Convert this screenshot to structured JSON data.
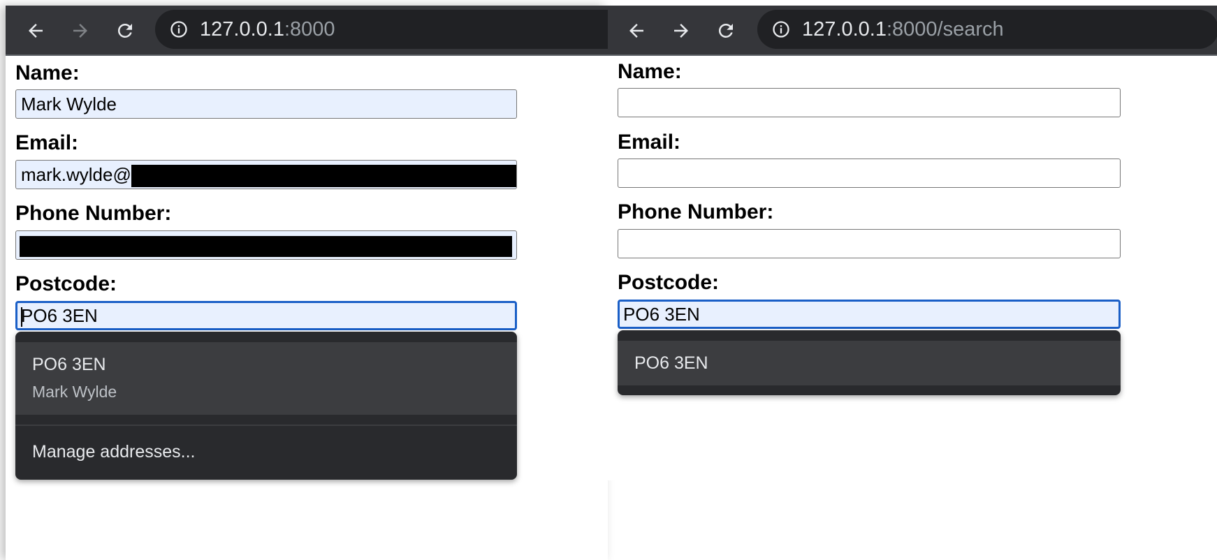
{
  "left_window": {
    "toolbar": {
      "back_icon": "arrow-left-icon",
      "forward_icon": "arrow-right-icon",
      "reload_icon": "reload-icon",
      "info_icon": "info-circle-icon",
      "url_host": "127.0.0.1",
      "url_rest": ":8000"
    },
    "form": {
      "name_label": "Name:",
      "name_value": "Mark Wylde",
      "email_label": "Email:",
      "email_value": "mark.wylde@",
      "phone_label": "Phone Number:",
      "phone_value": "",
      "postcode_label": "Postcode:",
      "postcode_value": "PO6 3EN"
    },
    "autofill": {
      "suggestion_title": "PO6 3EN",
      "suggestion_subtitle": "Mark Wylde",
      "manage_label": "Manage addresses..."
    }
  },
  "right_window": {
    "toolbar": {
      "back_icon": "arrow-left-icon",
      "forward_icon": "arrow-right-icon",
      "reload_icon": "reload-icon",
      "info_icon": "info-circle-icon",
      "url_host": "127.0.0.1",
      "url_rest": ":8000/search"
    },
    "form": {
      "name_label": "Name:",
      "name_value": "",
      "email_label": "Email:",
      "email_value": "",
      "phone_label": "Phone Number:",
      "phone_value": "",
      "postcode_label": "Postcode:",
      "postcode_value": "PO6 3EN"
    },
    "autocomplete": {
      "suggestion": "PO6 3EN"
    }
  },
  "colors": {
    "toolbar_bg": "#35363a",
    "omnibox_bg": "#202124",
    "autofill_bg": "#e8f0fe",
    "focus_border": "#1a5fc7",
    "dropdown_bg": "#292a2d",
    "dropdown_selected": "#3c3d40"
  }
}
